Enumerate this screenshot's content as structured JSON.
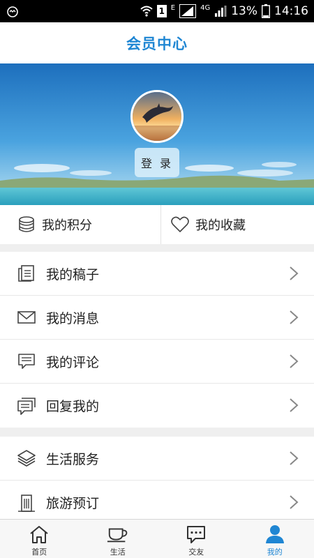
{
  "status_bar": {
    "network": "E",
    "sim_slot": "1",
    "network_type": "4G",
    "battery": "13%",
    "time": "14:16"
  },
  "header": {
    "title": "会员中心"
  },
  "profile": {
    "login_label": "登 录"
  },
  "quick_links": [
    {
      "label": "我的积分",
      "icon": "database-icon"
    },
    {
      "label": "我的收藏",
      "icon": "heart-icon"
    }
  ],
  "menu_group_1": [
    {
      "label": "我的稿子",
      "icon": "document-stack-icon"
    },
    {
      "label": "我的消息",
      "icon": "envelope-icon"
    },
    {
      "label": "我的评论",
      "icon": "comment-icon"
    },
    {
      "label": "回复我的",
      "icon": "reply-comment-icon"
    }
  ],
  "menu_group_2": [
    {
      "label": "生活服务",
      "icon": "layers-icon"
    },
    {
      "label": "旅游预订",
      "icon": "building-icon"
    }
  ],
  "tabbar": {
    "active": "我的",
    "tabs": [
      {
        "label": "首页",
        "icon": "home-icon"
      },
      {
        "label": "生活",
        "icon": "coffee-cup-icon"
      },
      {
        "label": "交友",
        "icon": "chat-icon"
      },
      {
        "label": "我的",
        "icon": "user-icon"
      }
    ]
  },
  "colors": {
    "accent": "#1f86d3",
    "text": "#222222",
    "divider": "#e8e8e8"
  }
}
